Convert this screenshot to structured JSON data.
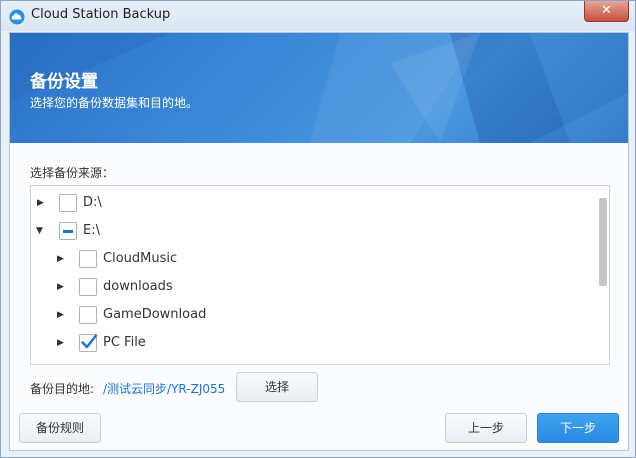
{
  "window": {
    "title": "Cloud Station Backup",
    "close_symbol": "✕"
  },
  "banner": {
    "title": "备份设置",
    "subtitle": "选择您的备份数据集和目的地。"
  },
  "source": {
    "label": "选择备份来源：",
    "items": [
      {
        "label": "D:\\",
        "state": "unchecked",
        "expander": "collapsed"
      },
      {
        "label": "E:\\",
        "state": "partial",
        "expander": "expanded"
      },
      {
        "label": "CloudMusic",
        "state": "unchecked",
        "expander": "collapsed"
      },
      {
        "label": "downloads",
        "state": "unchecked",
        "expander": "collapsed"
      },
      {
        "label": "GameDownload",
        "state": "unchecked",
        "expander": "collapsed"
      },
      {
        "label": "PC File",
        "state": "checked",
        "expander": "collapsed"
      }
    ]
  },
  "destination": {
    "label": "备份目的地:",
    "path": "/测试云同步/YR-ZJ055",
    "choose_label": "选择"
  },
  "footer": {
    "rules_label": "备份规则",
    "prev_label": "上一步",
    "next_label": "下一步"
  },
  "colors": {
    "accent": "#1a73d9",
    "banner": "#2c72c8",
    "primary_button": "#2a8ae4"
  }
}
